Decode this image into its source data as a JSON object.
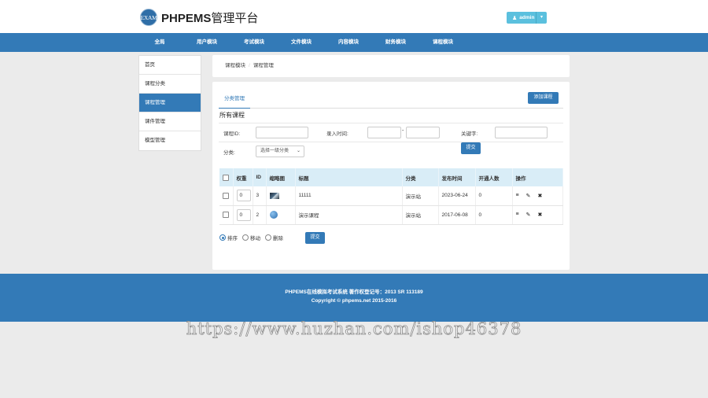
{
  "header": {
    "logo_badge": "EXAM",
    "title_brand": "PHPEMS",
    "title_rest": "管理平台",
    "user_name": "admin"
  },
  "nav": {
    "items": [
      "全局",
      "用户模块",
      "考试模块",
      "文件模块",
      "内容模块",
      "财务模块",
      "课程模块"
    ],
    "active": "课程模块"
  },
  "sidebar": {
    "items": [
      "首页",
      "课程分类",
      "课程管理",
      "课件管理",
      "模型管理"
    ],
    "active": "课程管理"
  },
  "breadcrumb": {
    "items": [
      "课程模块",
      "课程管理"
    ],
    "separator": "/"
  },
  "main": {
    "tab_label": "分类管理",
    "add_button": "添加课程",
    "section_title": "所有课程",
    "filters": {
      "course_id_label": "课程ID:",
      "time_label": "录入时间:",
      "time_separator": "-",
      "keyword_label": "关键字:",
      "category_label": "分类:",
      "category_select": "选择一级分类",
      "submit": "提交"
    },
    "table": {
      "headers": [
        "",
        "权重",
        "ID",
        "缩略图",
        "标题",
        "分类",
        "发布时间",
        "开通人数",
        "操作"
      ],
      "rows": [
        {
          "weight": "0",
          "id": "3",
          "title": "11111",
          "category": "演示站",
          "date": "2023-06-24",
          "users": "0"
        },
        {
          "weight": "0",
          "id": "2",
          "title": "演示课程",
          "category": "演示站",
          "date": "2017-06-08",
          "users": "0"
        }
      ]
    },
    "batch": {
      "options": [
        "排序",
        "移动",
        "删除"
      ],
      "selected": "排序",
      "submit": "提交"
    }
  },
  "footer": {
    "line1": "PHPEMS在线模拟考试系统 著作权登记号：2013 SR 113189",
    "line2": "Copyright © phpems.net 2015-2016"
  },
  "watermark": "https://www.huzhan.com/ishop46378",
  "colors": {
    "primary": "#337ab7",
    "info": "#5bc0de",
    "table_header": "#d9edf7",
    "background": "#ebebeb"
  }
}
